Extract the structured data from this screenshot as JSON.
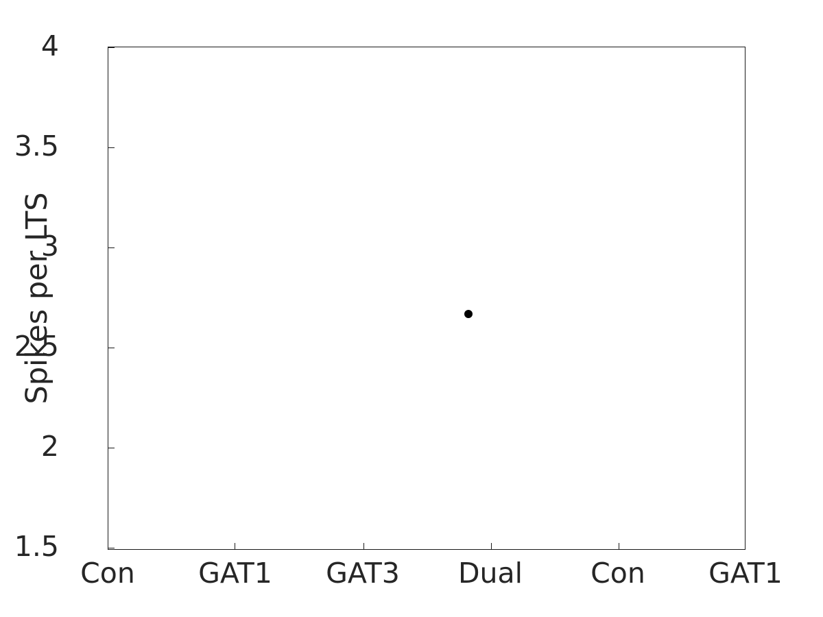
{
  "figure": {
    "background_color": "#ffffff",
    "foreground_color": "#262626",
    "axis_color": "#1a1a1a",
    "marker_color": "#000000"
  },
  "chart_data": {
    "type": "scatter",
    "title": "",
    "xlabel": "",
    "ylabel": "Spikes per LTS",
    "categories": [
      "Con",
      "GAT1",
      "GAT3",
      "Dual",
      "Con",
      "GAT1"
    ],
    "xtick_labels": [
      "Con",
      "GAT1",
      "GAT3",
      "Dual",
      "Con",
      "GAT1"
    ],
    "ytick_labels": [
      "4",
      "3.5",
      "3",
      "2.5",
      "2",
      "1.5"
    ],
    "ytick_values": [
      4,
      3.5,
      3,
      2.5,
      2,
      1.5
    ],
    "ylim": [
      1.5,
      4
    ],
    "xlim": [
      0,
      5
    ],
    "grid": false,
    "legend": null,
    "series": [
      {
        "name": "Spikes per LTS",
        "marker": "filled-circle",
        "color": "#000000",
        "points": [
          {
            "category": "Dual",
            "x": 2.83,
            "y": 2.67,
            "label": "2.67"
          }
        ]
      }
    ],
    "notes": "Single visible black filled circle marker near the 'Dual' category at approximately 2.67 spikes per LTS; all other categories have no plotted data within the axis limits."
  }
}
